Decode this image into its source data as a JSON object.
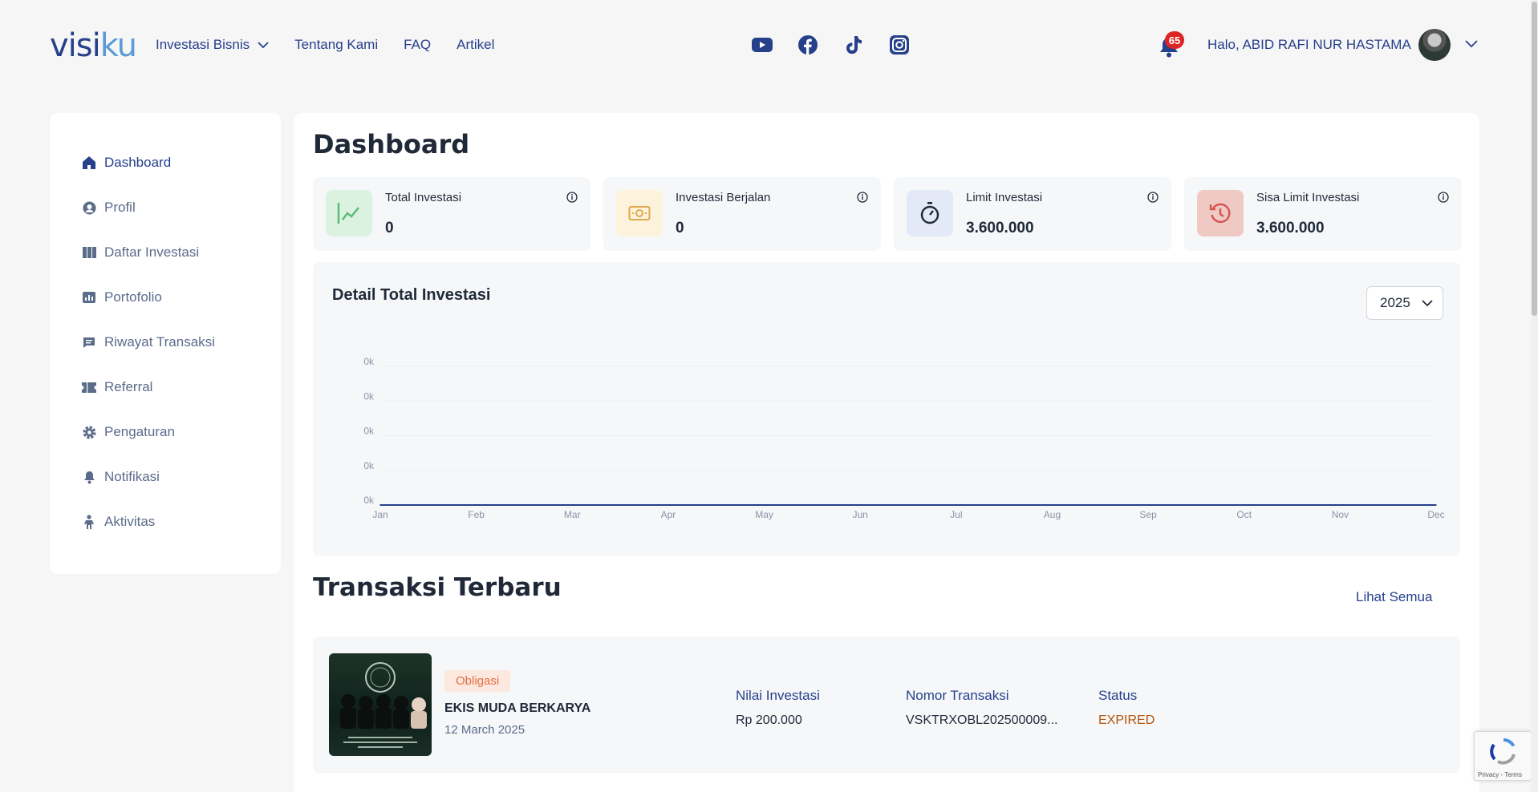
{
  "header": {
    "logo_a": "visi",
    "logo_b": "ku",
    "nav": [
      {
        "label": "Investasi Bisnis"
      },
      {
        "label": "Tentang Kami"
      },
      {
        "label": "FAQ"
      },
      {
        "label": "Artikel"
      }
    ],
    "notification_count": "65",
    "greeting": "Halo, ABID RAFI NUR HASTAMA",
    "icons": [
      "youtube-icon",
      "facebook-icon",
      "tiktok-icon",
      "instagram-icon",
      "bell-icon",
      "chevron-down-icon"
    ]
  },
  "sidebar": {
    "items": [
      {
        "label": "Dashboard",
        "icon": "home-icon",
        "active": true
      },
      {
        "label": "Profil",
        "icon": "user-icon"
      },
      {
        "label": "Daftar Investasi",
        "icon": "columns-icon"
      },
      {
        "label": "Portofolio",
        "icon": "chart-icon"
      },
      {
        "label": "Riwayat Transaksi",
        "icon": "message-icon"
      },
      {
        "label": "Referral",
        "icon": "ticket-icon"
      },
      {
        "label": "Pengaturan",
        "icon": "gear-icon"
      },
      {
        "label": "Notifikasi",
        "icon": "bell-icon"
      },
      {
        "label": "Aktivitas",
        "icon": "person-icon"
      }
    ]
  },
  "main": {
    "title": "Dashboard",
    "cards": [
      {
        "label": "Total Investasi",
        "value": "0",
        "icon": "trend-icon",
        "bg": "#dcf2e1",
        "fg": "#5cba78"
      },
      {
        "label": "Investasi Berjalan",
        "value": "0",
        "icon": "money-icon",
        "bg": "#fdf3dc",
        "fg": "#e0a94a"
      },
      {
        "label": "Limit Investasi",
        "value": "3.600.000",
        "icon": "stopwatch-icon",
        "bg": "#e4e9f7",
        "fg": "#1f2937"
      },
      {
        "label": "Sisa Limit Investasi",
        "value": "3.600.000",
        "icon": "history-icon",
        "bg": "#efc9c4",
        "fg": "#d9534f"
      }
    ],
    "chart_title": "Detail Total Investasi",
    "year": "2025",
    "transactions_title": "Transaksi Terbaru",
    "see_all": "Lihat Semua",
    "transaction": {
      "tag": "Obligasi",
      "name": "EKIS MUDA BERKARYA",
      "date": "12 March 2025",
      "amount_label": "Nilai Investasi",
      "amount": "Rp 200.000",
      "number_label": "Nomor Transaksi",
      "number": "VSKTRXOBL202500009...",
      "status_label": "Status",
      "status": "EXPIRED"
    }
  },
  "recaptcha": "Privacy - Terms",
  "chart_data": {
    "type": "line",
    "categories": [
      "Jan",
      "Feb",
      "Mar",
      "Apr",
      "May",
      "Jun",
      "Jul",
      "Aug",
      "Sep",
      "Oct",
      "Nov",
      "Dec"
    ],
    "series": [
      {
        "values": [
          0,
          0,
          0,
          0,
          0,
          0,
          0,
          0,
          0,
          0,
          0,
          0
        ]
      }
    ],
    "ytick_labels": [
      "0k",
      "0k",
      "0k",
      "0k",
      "0k"
    ],
    "ylim": [
      0,
      1
    ],
    "title": "Detail Total Investasi",
    "grid": true,
    "line_color": "#27408b"
  }
}
